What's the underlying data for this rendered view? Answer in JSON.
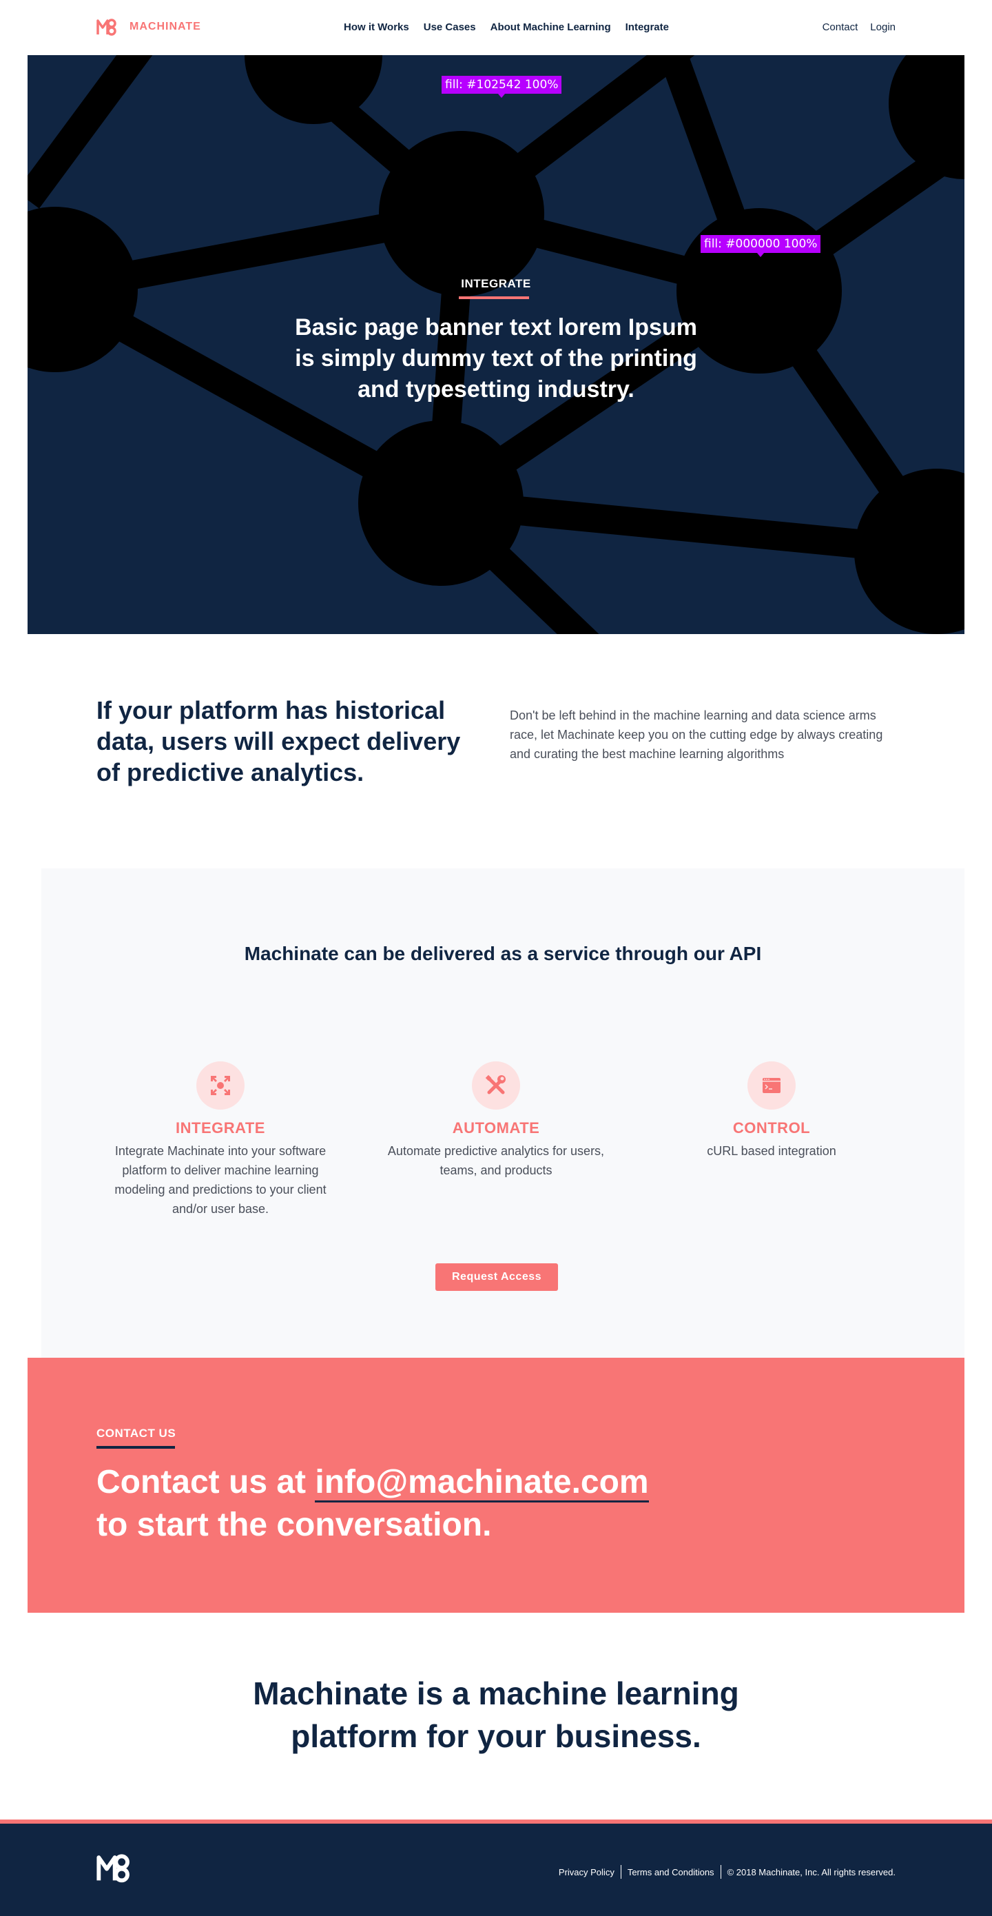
{
  "nav": {
    "brand": "MACHINATE",
    "links": [
      "How it Works",
      "Use Cases",
      "About Machine Learning",
      "Integrate"
    ],
    "contact": "Contact",
    "login": "Login"
  },
  "hero": {
    "eyebrow": "INTEGRATE",
    "title": "Basic page banner text lorem Ipsum is simply dummy text of the printing and typesetting industry.",
    "tag_background": "fill: #102542 100%",
    "tag_nodes": "fill: #000000 100%"
  },
  "intro": {
    "heading": "If your platform has historical data, users will expect delivery of predictive analytics.",
    "body": "Don't be left behind in the machine learning and data science arms race, let Machinate keep you on the cutting edge by always creating and curating the best machine learning algorithms"
  },
  "service": {
    "title": "Machinate can be delivered as a service through our API",
    "features": [
      {
        "icon": "collapse-arrows-icon",
        "title": "INTEGRATE",
        "text": "Integrate Machinate into your software platform to deliver machine learning modeling and predictions to your client and/or user base."
      },
      {
        "icon": "wrench-screwdriver-icon",
        "title": "AUTOMATE",
        "text": "Automate predictive analytics for users, teams, and products"
      },
      {
        "icon": "terminal-window-icon",
        "title": "CONTROL",
        "text": "cURL based integration"
      }
    ],
    "button": "Request Access"
  },
  "contact": {
    "eyebrow": "CONTACT US",
    "prefix": "Contact us at ",
    "email": "info@machinate.com",
    "suffix": "to start the conversation."
  },
  "tagline": "Machinate is a machine learning platform for your business.",
  "footer": {
    "privacy": "Privacy Policy",
    "terms": "Terms and Conditions",
    "copyright": "© 2018 Machinate, Inc. All rights reserved."
  },
  "colors": {
    "navy": "#102542",
    "coral": "#f87575",
    "tag": "#b700ff",
    "node": "#000000"
  }
}
